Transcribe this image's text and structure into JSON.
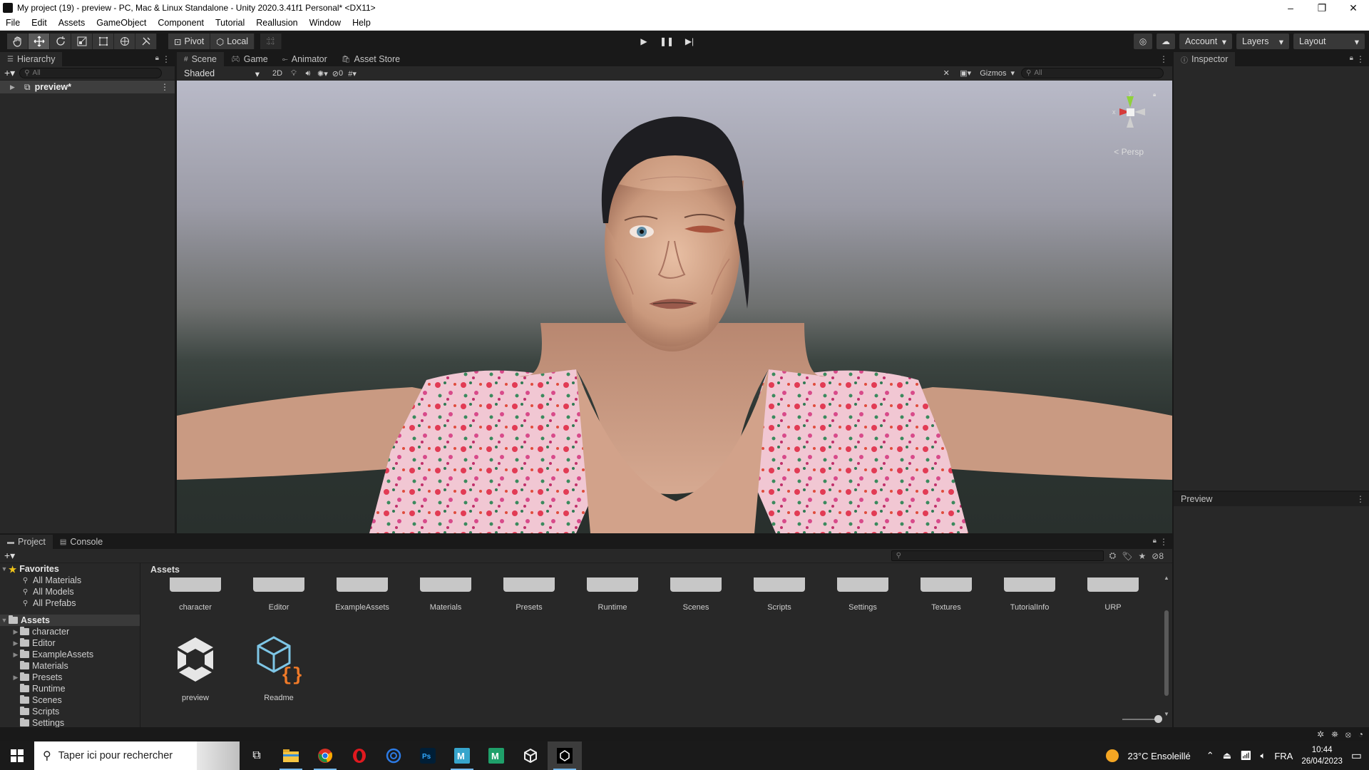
{
  "window": {
    "title": "My project (19) - preview - PC, Mac & Linux Standalone - Unity 2020.3.41f1 Personal* <DX11>",
    "minimize": "–",
    "restore": "❐",
    "close": "✕"
  },
  "menu": [
    "File",
    "Edit",
    "Assets",
    "GameObject",
    "Component",
    "Tutorial",
    "Reallusion",
    "Window",
    "Help"
  ],
  "toolbar": {
    "pivot_label": "Pivot",
    "local_label": "Local",
    "account_label": "Account",
    "layers_label": "Layers",
    "layout_label": "Layout"
  },
  "hierarchy": {
    "tab_label": "Hierarchy",
    "search_placeholder": "All",
    "items": [
      {
        "label": "preview*"
      }
    ]
  },
  "scene": {
    "tabs": [
      {
        "label": "Scene",
        "active": true
      },
      {
        "label": "Game"
      },
      {
        "label": "Animator"
      },
      {
        "label": "Asset Store"
      }
    ],
    "shading_mode": "Shaded",
    "mode_2d": "2D",
    "hidden_count": "0",
    "gizmos_label": "Gizmos",
    "search_placeholder": "All",
    "gizmo_x": "x",
    "gizmo_y": "y",
    "perspective_label": "Persp"
  },
  "inspector": {
    "tab_label": "Inspector"
  },
  "preview_panel": {
    "tab_label": "Preview"
  },
  "project": {
    "tabs": [
      {
        "label": "Project",
        "active": true
      },
      {
        "label": "Console"
      }
    ],
    "hidden_count": "8",
    "favorites": {
      "label": "Favorites",
      "items": [
        "All Materials",
        "All Models",
        "All Prefabs"
      ]
    },
    "assets_root": "Assets",
    "tree_folders": [
      "character",
      "Editor",
      "ExampleAssets",
      "Materials",
      "Presets",
      "Runtime",
      "Scenes",
      "Scripts",
      "Settings"
    ],
    "breadcrumb": "Assets",
    "grid_folders": [
      "character",
      "Editor",
      "ExampleAssets",
      "Materials",
      "Presets",
      "Runtime",
      "Scenes",
      "Scripts",
      "Settings",
      "Textures",
      "TutorialInfo",
      "URP"
    ],
    "grid_assets": [
      {
        "label": "preview",
        "icon": "unity-scene-icon"
      },
      {
        "label": "Readme",
        "icon": "readme-asset-icon"
      }
    ]
  },
  "taskbar": {
    "search_placeholder": "Taper ici pour rechercher",
    "weather": "23°C  Ensoleillé",
    "language": "FRA",
    "time": "10:44",
    "date": "26/04/2023"
  },
  "colors": {
    "editor_bg": "#191919",
    "panel_bg": "#282828",
    "selected_row": "#3e3e3e",
    "taskbar_bg": "#1a1a1a",
    "gizmo_x": "#d63b3b",
    "gizmo_y": "#8fd13b"
  }
}
